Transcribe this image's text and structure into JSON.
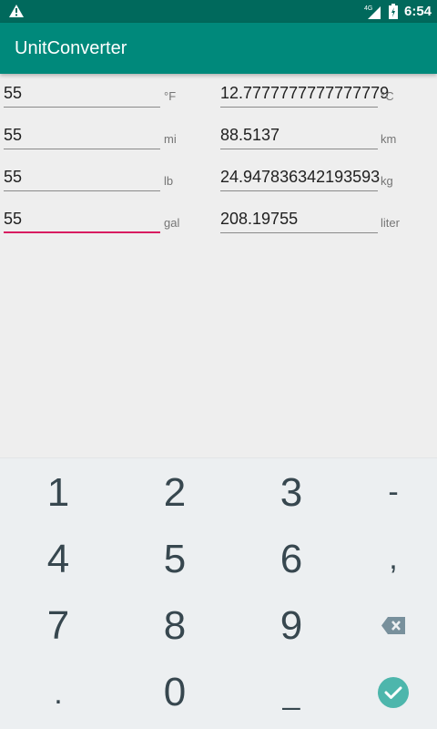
{
  "status_bar": {
    "time": "6:54",
    "network": "4G"
  },
  "app_bar": {
    "title": "UnitConverter"
  },
  "conversions": [
    {
      "input": "55",
      "from_unit": "°F",
      "output": "12.7777777777777779",
      "to_unit": "°C"
    },
    {
      "input": "55",
      "from_unit": "mi",
      "output": "88.5137",
      "to_unit": "km"
    },
    {
      "input": "55",
      "from_unit": "lb",
      "output": "24.947836342193593",
      "to_unit": "kg"
    },
    {
      "input": "55",
      "from_unit": "gal",
      "output": "208.19755",
      "to_unit": "liter"
    }
  ],
  "keyboard": {
    "keys": [
      "1",
      "2",
      "3",
      "-",
      "4",
      "5",
      "6",
      ",",
      "7",
      "8",
      "9",
      "backspace-icon",
      ".",
      "0",
      "_",
      "done-check-icon"
    ],
    "accent_color": "#4db6ac"
  },
  "colors": {
    "status_bar": "#00695c",
    "app_bar": "#00897b",
    "active_underline": "#d81b60"
  }
}
